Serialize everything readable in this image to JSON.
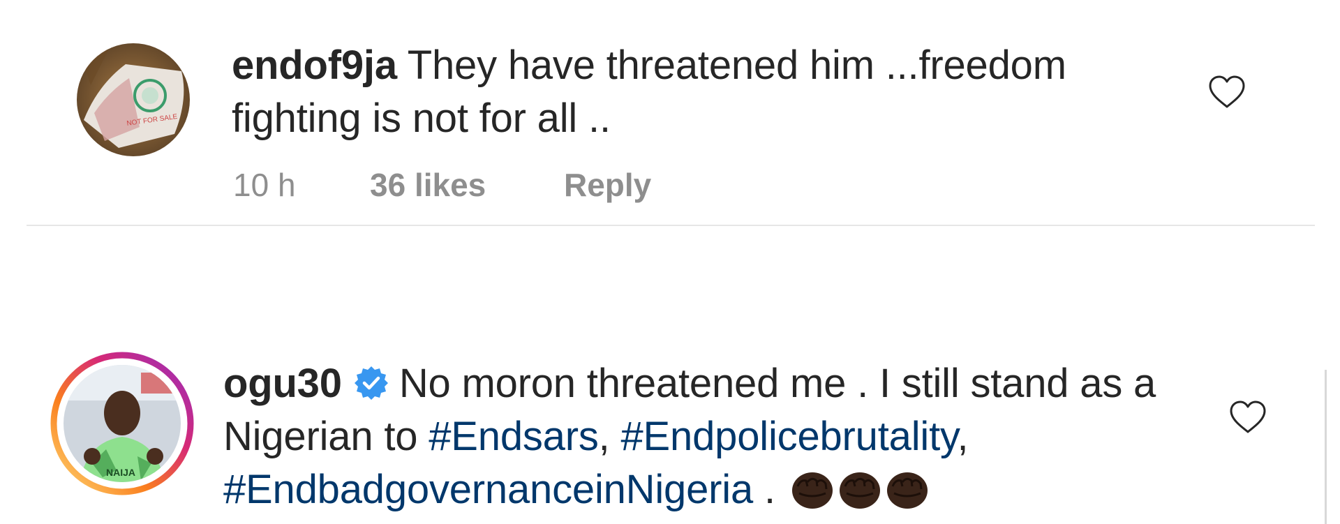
{
  "comments": [
    {
      "username": "endof9ja",
      "text": "They have threatened him ...freedom fighting is not for all ..",
      "time": "10 h",
      "likes": "36 likes",
      "reply_label": "Reply",
      "avatar_icon": "avatar-image",
      "like_icon": "heart-outline-icon"
    },
    {
      "username": "ogu30",
      "verified": true,
      "verified_icon": "verified-badge-icon",
      "text_plain_1": "No moron threatened me . I still stand as a Nigerian to",
      "hashtags": [
        "#Endsars",
        "#Endpolicebrutality",
        "#EndbadgovernanceinNigeria"
      ],
      "text_separator": ",",
      "text_tail": ".",
      "emoji": [
        "raised-fist-icon",
        "raised-fist-icon",
        "raised-fist-icon"
      ],
      "avatar_icon": "avatar-story-ring-image",
      "like_icon": "heart-outline-icon"
    }
  ],
  "colors": {
    "text": "#262626",
    "muted": "#8e8e8e",
    "hashtag": "#00376b",
    "verified": "#3897f0",
    "divider": "#e6e6e6"
  }
}
